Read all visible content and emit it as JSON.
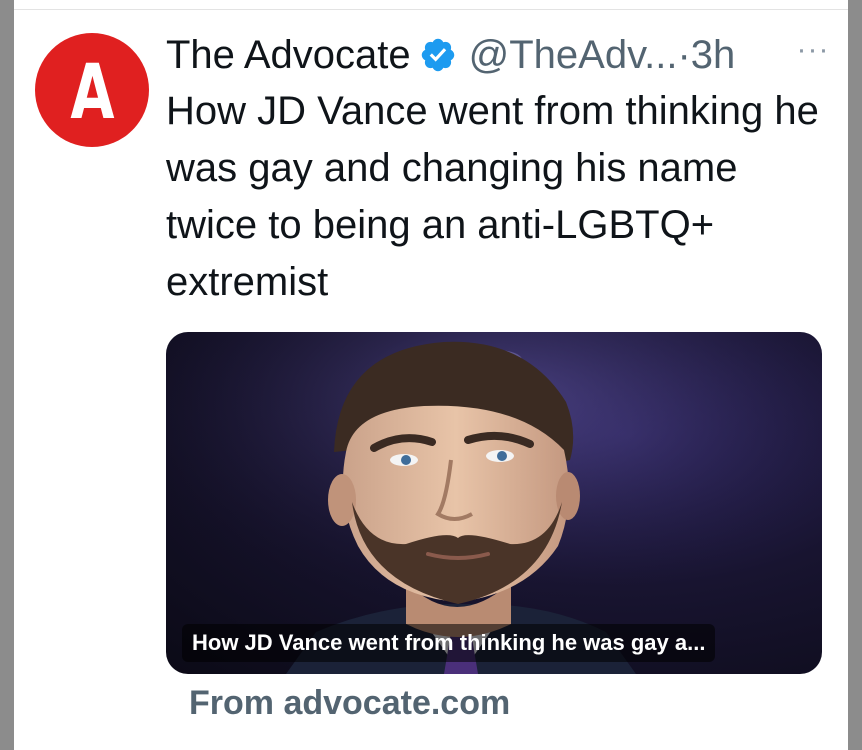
{
  "tweet": {
    "avatar_letter": "A",
    "display_name": "The Advocate",
    "handle": "@TheAdv...",
    "separator": "·",
    "time": "3h",
    "more_label": "···",
    "text": "How JD Vance went from thinking he was gay and changing his name twice to being an anti-LGBTQ+ extremist"
  },
  "link_card": {
    "caption": "How JD Vance went from thinking he was gay a...",
    "source": "From advocate.com"
  },
  "colors": {
    "avatar_bg": "#e02020",
    "verified_blue": "#1d9bf0",
    "secondary_text": "#536471"
  }
}
